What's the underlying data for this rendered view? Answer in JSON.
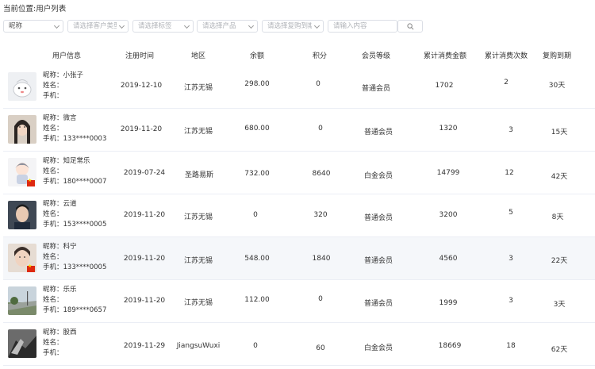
{
  "breadcrumb": "当前位置:用户列表",
  "filters": {
    "nickname_select": "昵称",
    "customer_type": "请选择客户类型",
    "tag": "请选择标签",
    "product": "请选择产品",
    "repurchase": "请选择复购到期",
    "search_placeholder": "请输入内容"
  },
  "table": {
    "headers": [
      "用户信息",
      "注册时间",
      "地区",
      "余额",
      "积分",
      "会员等级",
      "累计消费金额",
      "累计消费次数",
      "复购到期"
    ],
    "info_labels": {
      "nickname": "昵称：",
      "name": "姓名：",
      "phone": "手机："
    },
    "rows": [
      {
        "nickname": "小张子",
        "name": "",
        "phone": "",
        "reg": "2019-12-10",
        "region": "江苏无锡",
        "balance": "298.00",
        "points": "0",
        "level": "普通会员",
        "spent": "1702",
        "count": "2",
        "due": "30天"
      },
      {
        "nickname": "微言",
        "name": "",
        "phone": "133****0003",
        "reg": "2019-11-20",
        "region": "江苏无锡",
        "balance": "680.00",
        "points": "0",
        "level": "普通会员",
        "spent": "1320",
        "count": "3",
        "due": "15天"
      },
      {
        "nickname": "知足常乐",
        "name": "",
        "phone": "180****0007",
        "reg": "2019-07-24",
        "region": "圣路易斯",
        "balance": "732.00",
        "points": "8640",
        "level": "白金会员",
        "spent": "14799",
        "count": "12",
        "due": "42天"
      },
      {
        "nickname": "云道",
        "name": "",
        "phone": "153****0005",
        "reg": "2019-11-20",
        "region": "江苏无锡",
        "balance": "0",
        "points": "320",
        "level": "普通会员",
        "spent": "3200",
        "count": "5",
        "due": "8天"
      },
      {
        "nickname": "科宁",
        "name": "",
        "phone": "133****0005",
        "reg": "2019-11-20",
        "region": "江苏无锡",
        "balance": "548.00",
        "points": "1840",
        "level": "普通会员",
        "spent": "4560",
        "count": "3",
        "due": "22天"
      },
      {
        "nickname": "乐乐",
        "name": "",
        "phone": "189****0657",
        "reg": "2019-11-20",
        "region": "江苏无锡",
        "balance": "112.00",
        "points": "0",
        "level": "普通会员",
        "spent": "1999",
        "count": "3",
        "due": "3天"
      },
      {
        "nickname": "股西",
        "name": "",
        "phone": "",
        "reg": "2019-11-29",
        "region": "JiangsuWuxi",
        "balance": "0",
        "points": "60",
        "level": "白金会员",
        "spent": "18669",
        "count": "18",
        "due": "62天"
      }
    ]
  }
}
